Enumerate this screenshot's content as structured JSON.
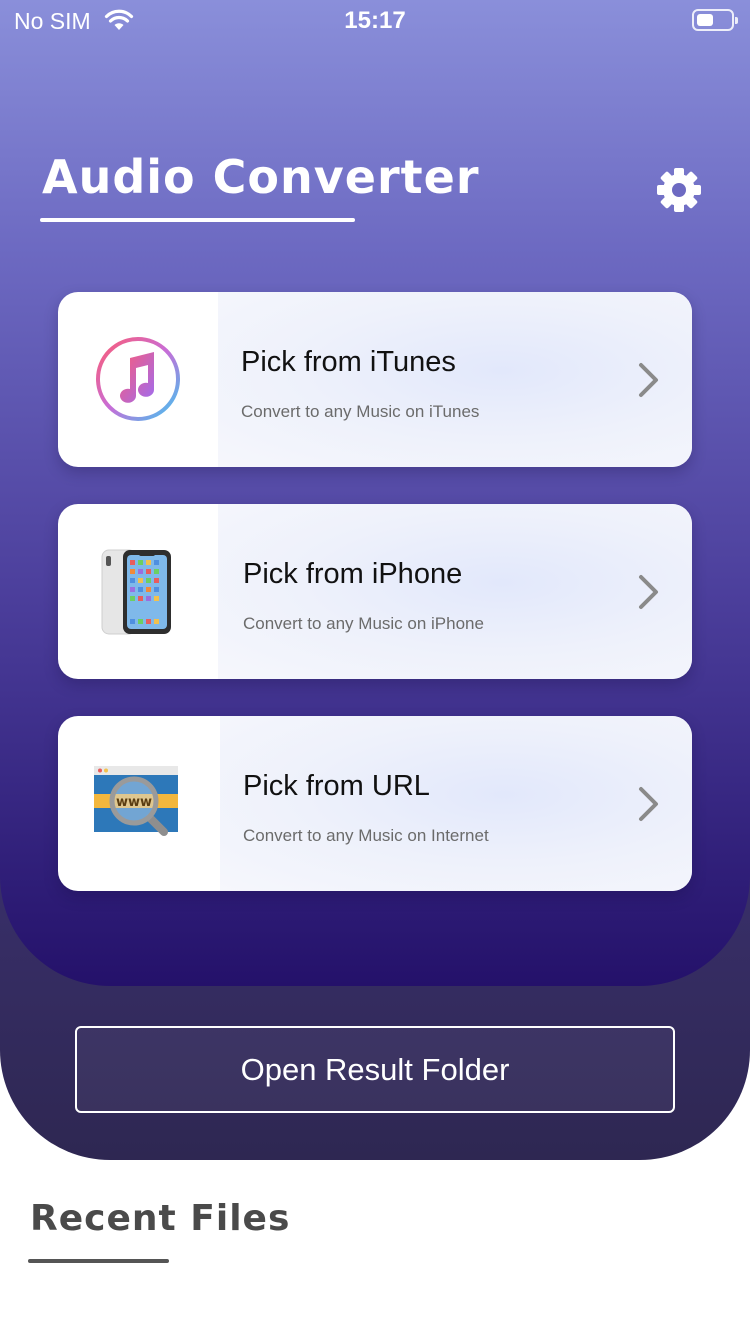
{
  "status_bar": {
    "carrier": "No SIM",
    "time": "15:17",
    "wifi_icon": "wifi-icon",
    "battery_icon": "battery-icon",
    "battery_level": 0.5
  },
  "header": {
    "title": "Audio Converter",
    "settings_icon": "gear-icon"
  },
  "sources": [
    {
      "title": "Pick from iTunes",
      "subtitle": "Convert to any Music on iTunes",
      "icon": "itunes-music-note-icon"
    },
    {
      "title": "Pick from iPhone",
      "subtitle": "Convert to any Music on iPhone",
      "icon": "iphone-icon"
    },
    {
      "title": "Pick from URL",
      "subtitle": "Convert to any Music on Internet",
      "icon": "www-magnifier-icon",
      "icon_text": "www"
    }
  ],
  "result_button": {
    "label": "Open Result Folder"
  },
  "recent": {
    "title": "Recent Files"
  },
  "colors": {
    "gradient_top": "#8a8fda",
    "gradient_bottom": "#24116a",
    "outer_panel": "#3f3478",
    "card_bg": "#ffffff",
    "text_dark": "#111111",
    "text_muted": "#6b6b6b"
  }
}
